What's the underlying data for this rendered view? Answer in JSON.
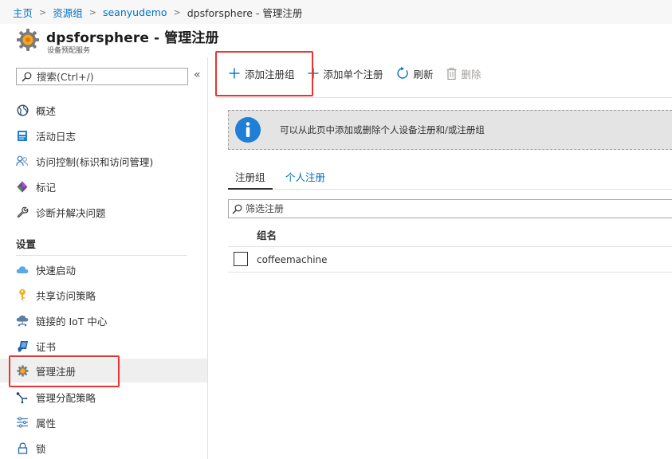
{
  "breadcrumb": {
    "items": [
      "主页",
      "资源组",
      "seanyudemo",
      "dpsforsphere - 管理注册"
    ]
  },
  "header": {
    "title": "dpsforsphere - 管理注册",
    "subtitle": "设备预配服务"
  },
  "sidebar": {
    "search_placeholder": "搜索(Ctrl+/)",
    "collapse_glyph": "«",
    "items_top": [
      {
        "label": "概述",
        "icon": "globe-icon"
      },
      {
        "label": "活动日志",
        "icon": "activity-log-icon"
      },
      {
        "label": "访问控制(标识和访问管理)",
        "icon": "people-icon"
      },
      {
        "label": "标记",
        "icon": "tag-icon"
      },
      {
        "label": "诊断并解决问题",
        "icon": "wrench-icon"
      }
    ],
    "section_label": "设置",
    "items_settings": [
      {
        "label": "快速启动",
        "icon": "cloud-icon"
      },
      {
        "label": "共享访问策略",
        "icon": "key-icon"
      },
      {
        "label": "链接的 IoT 中心",
        "icon": "iot-hub-icon"
      },
      {
        "label": "证书",
        "icon": "certificate-icon"
      },
      {
        "label": "管理注册",
        "icon": "gear-icon",
        "selected": true
      },
      {
        "label": "管理分配策略",
        "icon": "allocation-icon"
      },
      {
        "label": "属性",
        "icon": "properties-icon"
      },
      {
        "label": "锁",
        "icon": "lock-icon"
      }
    ]
  },
  "toolbar": {
    "add_group_label": "添加注册组",
    "add_single_label": "添加单个注册",
    "refresh_label": "刷新",
    "delete_label": "删除"
  },
  "banner": {
    "text": "可以从此页中添加或删除个人设备注册和/或注册组"
  },
  "tabs": [
    "注册组",
    "个人注册"
  ],
  "filter": {
    "placeholder": "筛选注册"
  },
  "table": {
    "columns": [
      "组名"
    ],
    "rows": [
      {
        "name": "coffeemachine"
      }
    ]
  },
  "colors": {
    "link": "#0072c6",
    "highlight": "#e8352f",
    "info_blue": "#1e7fd4",
    "banner_bg": "#e4e4e4"
  }
}
